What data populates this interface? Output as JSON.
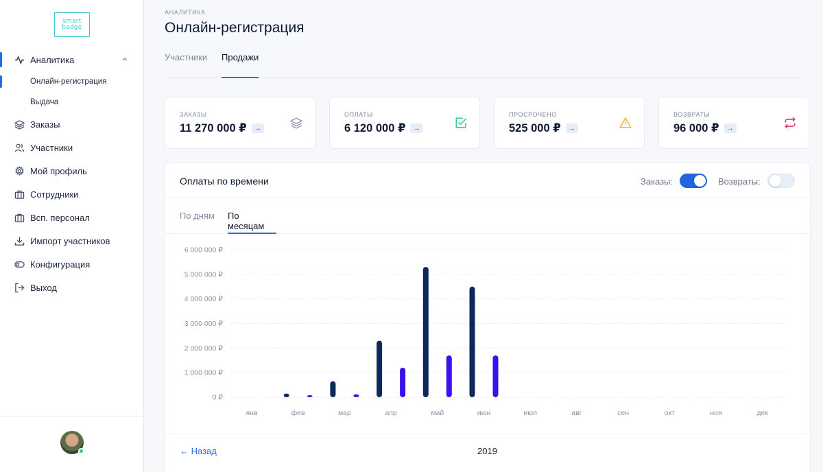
{
  "logo": {
    "line1": "smart",
    "line2": "badge"
  },
  "sidebar": {
    "items": [
      {
        "label": "Аналитика",
        "icon": "activity-icon"
      },
      {
        "label": "Заказы",
        "icon": "layers-icon"
      },
      {
        "label": "Участники",
        "icon": "users-icon"
      },
      {
        "label": "Мой профиль",
        "icon": "gear-icon"
      },
      {
        "label": "Сотрудники",
        "icon": "briefcase-icon"
      },
      {
        "label": "Всп. персонал",
        "icon": "briefcase-icon"
      },
      {
        "label": "Импорт участников",
        "icon": "download-icon"
      },
      {
        "label": "Конфигурация",
        "icon": "toggle-icon"
      },
      {
        "label": "Выход",
        "icon": "logout-icon"
      }
    ],
    "sub_items": [
      "Онлайн-регистрация",
      "Выдача"
    ]
  },
  "header": {
    "breadcrumb": "АНАЛИТИКА",
    "title": "Онлайн-регистрация"
  },
  "tabs": [
    "Участники",
    "Продажи"
  ],
  "stats": [
    {
      "label": "ЗАКАЗЫ",
      "value": "11 270 000 ₽",
      "icon": "layers-icon",
      "color": "#8a95a8"
    },
    {
      "label": "ОПЛАТЫ",
      "value": "6 120 000 ₽",
      "icon": "check-square-icon",
      "color": "#2fcf8a"
    },
    {
      "label": "ПРОСРОЧЕНО",
      "value": "525 000 ₽",
      "icon": "alert-triangle-icon",
      "color": "#f1b82d"
    },
    {
      "label": "ВОЗВРАТЫ",
      "value": "96 000 ₽",
      "icon": "repeat-icon",
      "color": "#e8325d"
    }
  ],
  "arrow": "→",
  "panel": {
    "title": "Оплаты по времени",
    "toggle_orders_label": "Заказы:",
    "toggle_orders_on": true,
    "toggle_returns_label": "Возвраты:",
    "toggle_returns_on": false,
    "subtabs": [
      "По дням",
      "По месяцам"
    ],
    "back_label": "← Назад",
    "year": "2019"
  },
  "chart_data": {
    "type": "bar",
    "categories": [
      "янв",
      "фев",
      "мар",
      "апр",
      "май",
      "июн",
      "июл",
      "авг",
      "сен",
      "окт",
      "ноя",
      "дек"
    ],
    "series": [
      {
        "color": "#0b2a5b",
        "values": [
          0,
          150000,
          650000,
          2300000,
          5300000,
          4500000,
          0,
          0,
          0,
          0,
          0,
          0
        ]
      },
      {
        "color": "#3a10f0",
        "values": [
          0,
          30000,
          120000,
          1200000,
          1700000,
          1700000,
          0,
          0,
          0,
          0,
          0,
          0
        ]
      }
    ],
    "yticks": [
      "0 ₽",
      "1 000 000 ₽",
      "2 000 000 ₽",
      "3 000 000 ₽",
      "4 000 000 ₽",
      "5 000 000 ₽",
      "6 000 000 ₽"
    ],
    "ylim": [
      0,
      6000000
    ],
    "grid": true
  }
}
